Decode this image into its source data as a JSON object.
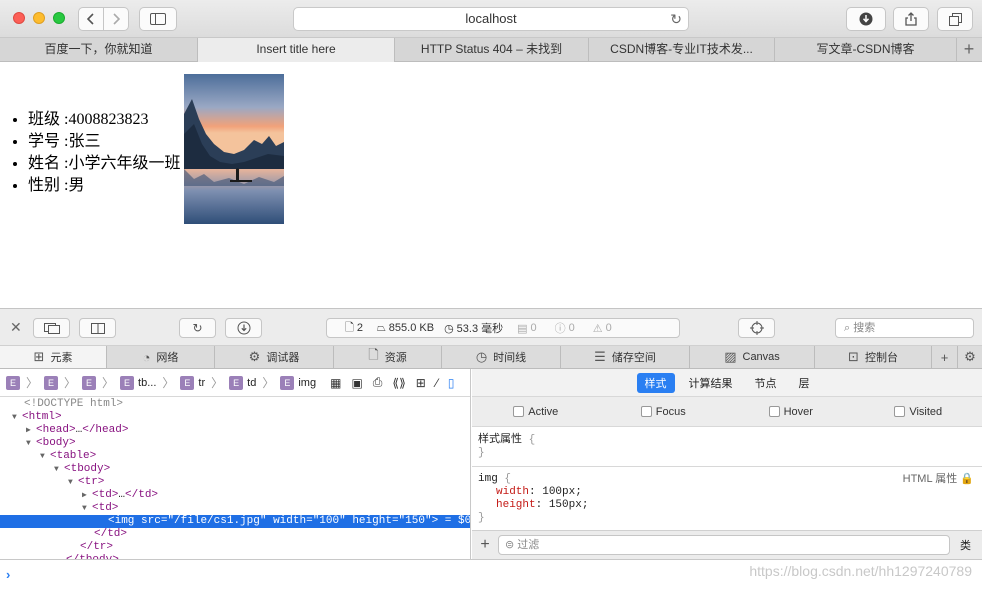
{
  "browser": {
    "address": "localhost",
    "tabs": [
      {
        "label": "百度一下，你就知道",
        "active": false
      },
      {
        "label": "Insert title here",
        "active": true
      },
      {
        "label": "HTTP Status 404 – 未找到",
        "active": false
      },
      {
        "label": "CSDN博客-专业IT技术发...",
        "active": false
      },
      {
        "label": "写文章-CSDN博客",
        "active": false
      }
    ]
  },
  "page": {
    "items": [
      "班级 :4008823823",
      "学号 :张三",
      "姓名 :小学六年级一班",
      "性别 :男"
    ]
  },
  "devtools": {
    "stats": {
      "requests": "2",
      "size": "855.0 KB",
      "time": "53.3 毫秒",
      "logs": "0",
      "errors": "0",
      "warnings": "0"
    },
    "search_placeholder": "搜索",
    "tabs": [
      "元素",
      "网络",
      "调试器",
      "资源",
      "时间线",
      "储存空间",
      "Canvas",
      "控制台"
    ],
    "breadcrumb": [
      "tb...",
      "tr",
      "td",
      "img"
    ],
    "dom": {
      "doctype": "<!DOCTYPE html>",
      "selected_src": "\"/file/cs1.jpg\"",
      "selected_width": "\"100\"",
      "selected_height": "\"150\"",
      "selected_suffix": "= $0"
    },
    "style_tabs": [
      "样式",
      "计算结果",
      "节点",
      "层"
    ],
    "pseudo": [
      "Active",
      "Focus",
      "Hover",
      "Visited"
    ],
    "style_attr_title": "样式属性",
    "img_rule": {
      "selector": "img",
      "origin": "HTML 属性",
      "props": [
        {
          "name": "width",
          "value": "100px"
        },
        {
          "name": "height",
          "value": "150px"
        }
      ]
    },
    "filter_placeholder": "过滤",
    "filter_class": "类"
  },
  "watermark": "https://blog.csdn.net/hh1297240789"
}
